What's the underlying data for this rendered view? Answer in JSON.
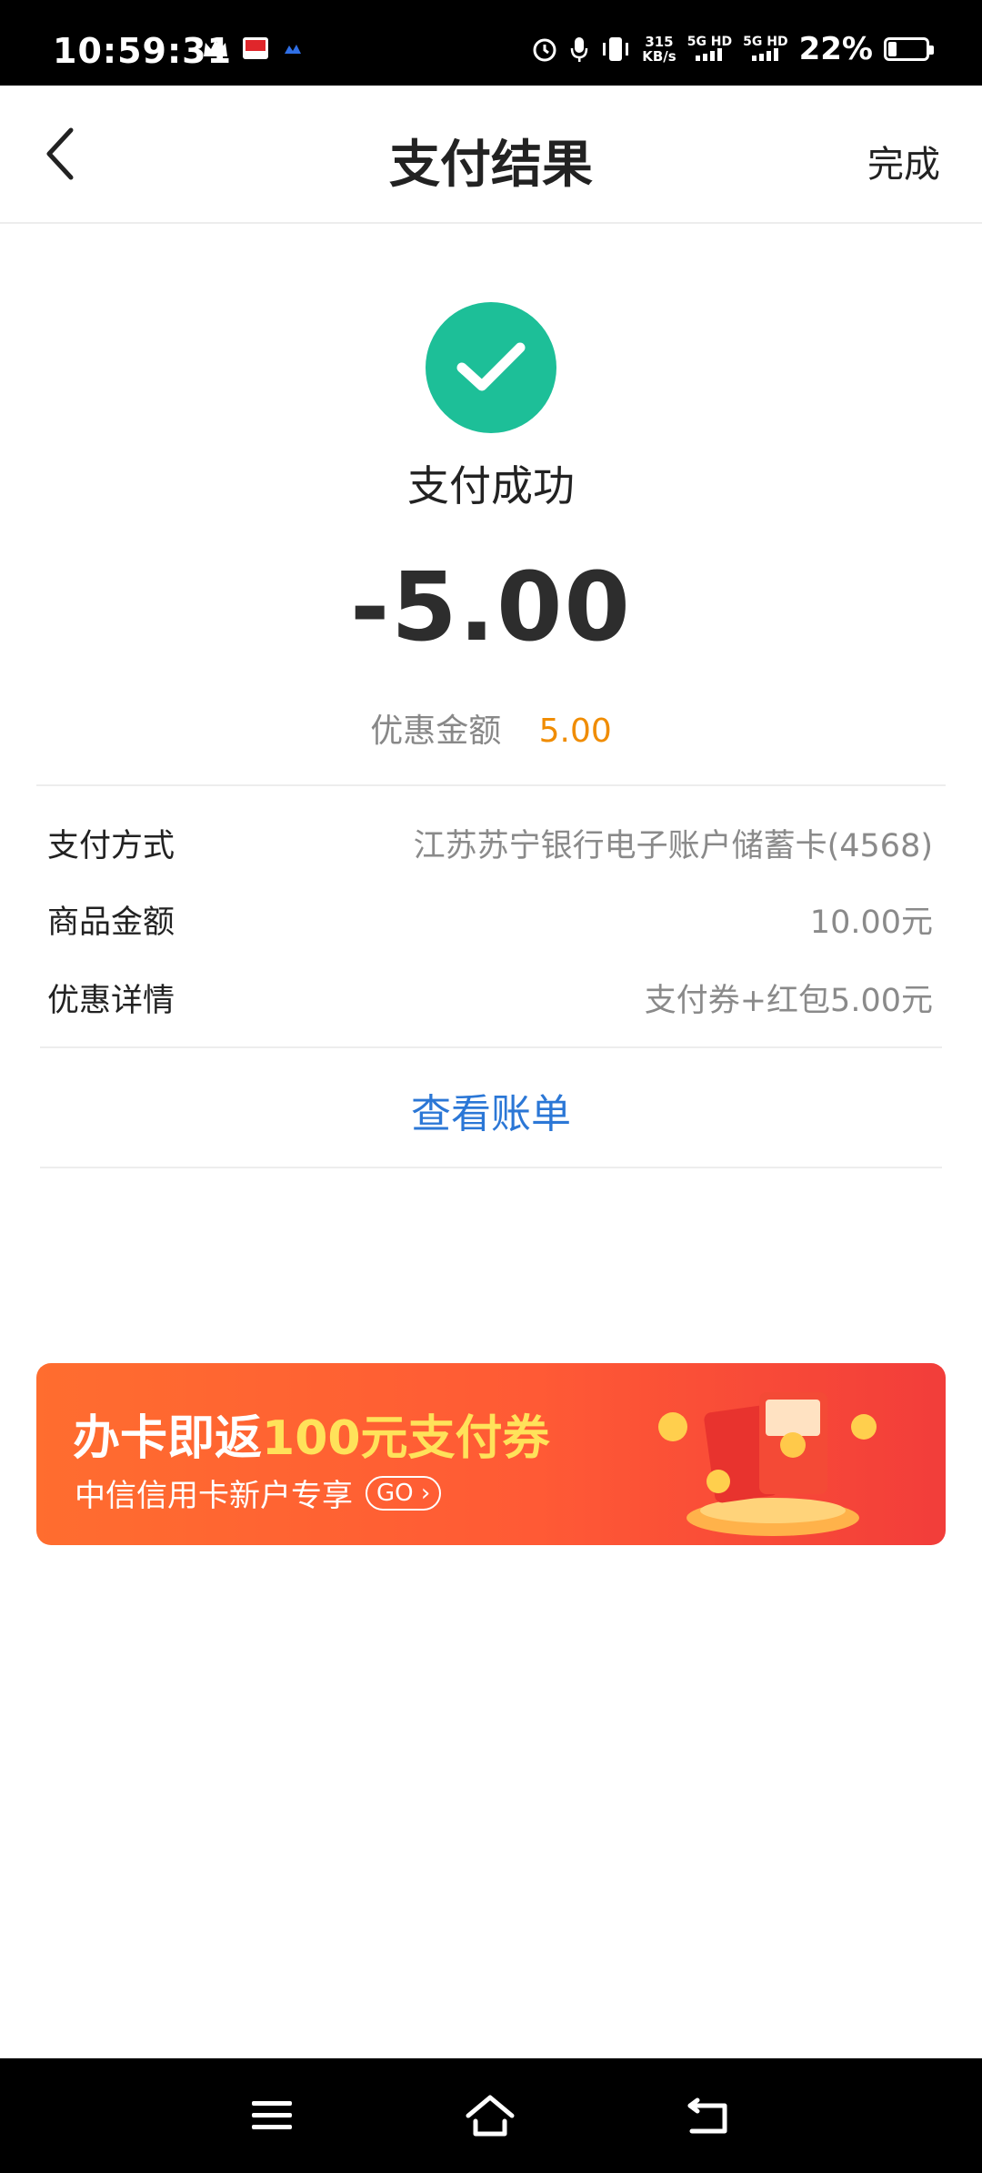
{
  "status_bar": {
    "time": "10:59:31",
    "net_speed_value": "315",
    "net_speed_unit": "KB/s",
    "sim1": "5G HD",
    "sim2": "5G HD",
    "battery_percent": "22%",
    "battery_level": 0.22
  },
  "header": {
    "title": "支付结果",
    "done_label": "完成"
  },
  "result": {
    "status_text": "支付成功",
    "amount": "-5.00",
    "discount_label": "优惠金额",
    "discount_value": "5.00",
    "success_color": "#1dbf98"
  },
  "details": [
    {
      "key": "支付方式",
      "value": "江苏苏宁银行电子账户储蓄卡(4568)"
    },
    {
      "key": "商品金额",
      "value": "10.00元"
    },
    {
      "key": "优惠详情",
      "value": "支付券+红包5.00元"
    }
  ],
  "view_bill_label": "查看账单",
  "banner": {
    "title_prefix": "办卡即返",
    "title_highlight": "100元支付券",
    "subtitle": "中信信用卡新户专享",
    "go_label": "GO"
  },
  "colors": {
    "accent_link": "#2b77d6",
    "discount": "#f08c00"
  }
}
